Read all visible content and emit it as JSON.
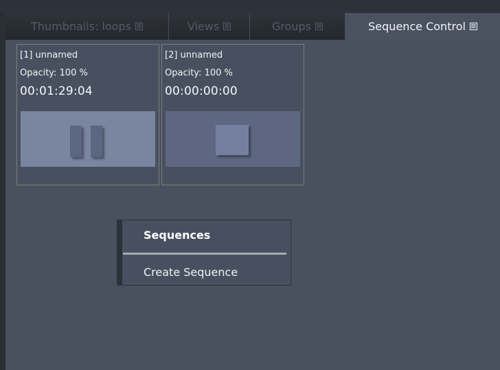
{
  "tabs": [
    {
      "label": "Thumbnails: loops",
      "active": false
    },
    {
      "label": "Views",
      "active": false
    },
    {
      "label": "Groups",
      "active": false
    },
    {
      "label": "Sequence Control",
      "active": true
    }
  ],
  "close_glyph": "⊠",
  "sequences": [
    {
      "name": "[1] unnamed",
      "opacity": "Opacity: 100 %",
      "time": "00:01:29:04",
      "state": "paused"
    },
    {
      "name": "[2] unnamed",
      "opacity": "Opacity: 100 %",
      "time": "00:00:00:00",
      "state": "stopped"
    }
  ],
  "context_menu": {
    "header": "Sequences",
    "items": [
      "Create Sequence"
    ]
  },
  "colors": {
    "panel_bg": "#49515f",
    "active_tab_bg": "#4a5260",
    "preview_paused": "#7a86a0",
    "preview_stopped": "#5d6880"
  },
  "icons": {
    "tab_close": "close-box-icon",
    "pause": "pause-icon",
    "stop": "stop-icon"
  }
}
